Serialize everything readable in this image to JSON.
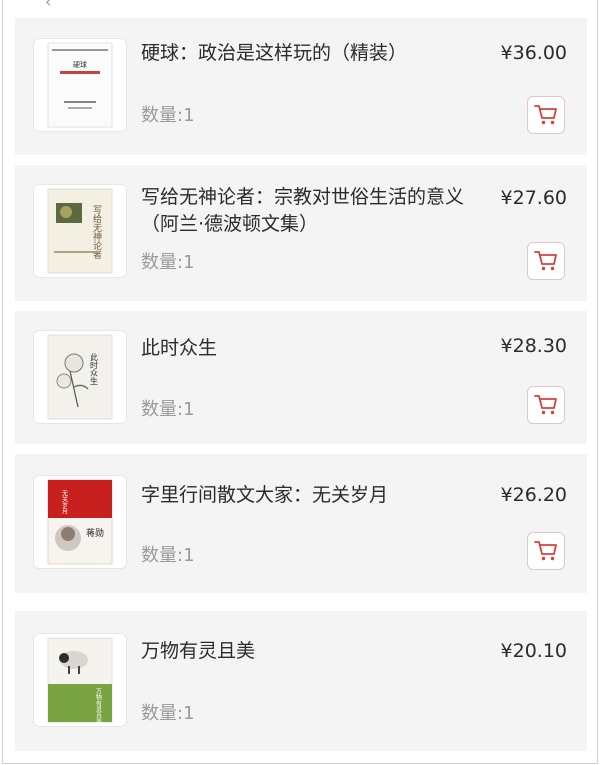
{
  "colors": {
    "row_bg": "#f4f4f4",
    "accent": "#d9403b"
  },
  "qty_label": "数量:1",
  "items": [
    {
      "title": "硬球：政治是这样玩的（精装）",
      "price": "¥36.00",
      "quantity": "数量:1",
      "cover_icon": "book-cover-white",
      "cover_text": "硬球"
    },
    {
      "title": "写给无神论者：宗教对世俗生活的意义（阿兰·德波顿文集）",
      "price": "¥27.60",
      "quantity": "数量:1",
      "cover_icon": "book-cover-cream",
      "cover_text": "写给无神论者"
    },
    {
      "title": "此时众生",
      "price": "¥28.30",
      "quantity": "数量:1",
      "cover_icon": "book-cover-flower",
      "cover_text": "此时众生"
    },
    {
      "title": "字里行间散文大家：无关岁月",
      "price": "¥26.20",
      "quantity": "数量:1",
      "cover_icon": "book-cover-red",
      "cover_text": "蒋勋"
    },
    {
      "title": "万物有灵且美",
      "price": "¥20.10",
      "quantity": "数量:1",
      "cover_icon": "book-cover-green",
      "cover_text": "万物有灵且美"
    }
  ]
}
